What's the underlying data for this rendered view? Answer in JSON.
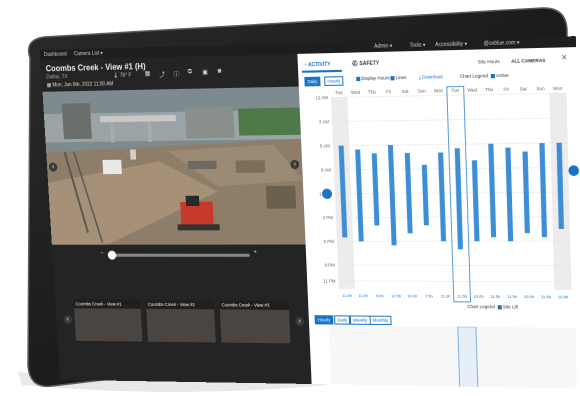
{
  "top_nav": {
    "dashboard": "Dashboard",
    "camera_list": "Camera List ▾",
    "admin": "Admin ▾",
    "tools": "Tools ▾",
    "account": "Accessibility ▾",
    "user_email": "@oxblue.com ▾"
  },
  "camera": {
    "title": "Coombs Creek - View #1 (H)",
    "location": "Dallas, TX",
    "datetime": "Mon, Jan 6th, 2022 11:00 AM",
    "sensor": "76° F"
  },
  "thumbnails": [
    {
      "label": "Coombs Creek - View #1"
    },
    {
      "label": "Coombs Creek - View #2"
    },
    {
      "label": "Coombs Creek - View #3"
    }
  ],
  "panel": {
    "tab_activity": "ACTIVITY",
    "tab_safety": "SAFETY",
    "filter_cameras": "Site Hours",
    "filter_all": "ALL CAMERAS",
    "seg_primary": "Daily",
    "seg_secondary": "Hourly",
    "display_hours": "Display Hours",
    "display_lines": "Lines",
    "download": "Download",
    "chart_legend_label": "Chart Legend",
    "legend_active": "Active",
    "bottom_legend_label": "Chart Legend",
    "bottom_legend_value": "Site Lift",
    "bottom_segs": [
      "Hourly",
      "Daily",
      "Weekly",
      "Monthly"
    ],
    "close_icon": "close-icon",
    "colors": {
      "accent": "#1a73c7",
      "bar": "#3e8ed6",
      "shade": "#ececec"
    }
  },
  "chart_data": {
    "type": "bar",
    "title": "",
    "categories": [
      "Tue",
      "Wed",
      "Thu",
      "Fri",
      "Sat",
      "Sun",
      "Mon",
      "Tue",
      "Wed",
      "Thu",
      "Fri",
      "Sat",
      "Sun",
      "Mon"
    ],
    "ytick_labels": [
      "12 AM",
      "3 AM",
      "6 AM",
      "9 AM",
      "12 PM",
      "3 PM",
      "6 PM",
      "9 PM",
      "11 PM"
    ],
    "series": [
      {
        "values_start_hour": [
          6.0,
          6.5,
          7.0,
          6.0,
          7.0,
          8.5,
          7.0,
          6.5,
          8.0,
          6.0,
          6.5,
          7.0,
          6.0,
          6.0
        ],
        "values_end_hour": [
          17.5,
          18.0,
          16.0,
          18.5,
          17.0,
          16.0,
          18.0,
          19.0,
          18.0,
          17.5,
          18.0,
          17.0,
          17.5,
          16.5
        ]
      }
    ],
    "bar_labels": [
      "11.0h",
      "11.5h",
      "9.0h",
      "12.5h",
      "10.0h",
      "7.5h",
      "11.0h",
      "12.5h",
      "10.0h",
      "11.5h",
      "11.5h",
      "10.0h",
      "11.5h",
      "10.5h"
    ],
    "ylim": [
      0,
      24
    ],
    "grid": true
  }
}
